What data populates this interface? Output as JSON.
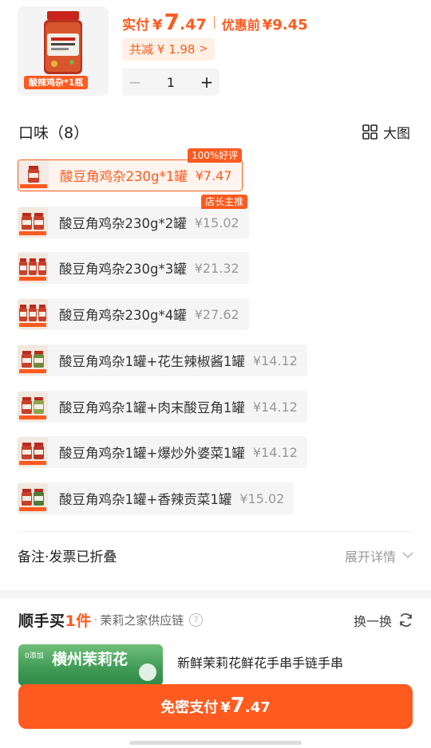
{
  "header": {
    "thumb_tag": "酸辣鸡杂*1瓶",
    "pay_label": "实付",
    "pay_currency": "¥",
    "pay_int": "7",
    "pay_dec": ".47",
    "orig_label": "优惠前",
    "orig_value": "¥9.45",
    "discount_text": "共减 ¥ 1.98",
    "quantity": "1",
    "minus": "−",
    "plus": "+"
  },
  "flavor": {
    "title": "口味（8）",
    "big_view_label": "大图",
    "options": [
      {
        "label": "酸豆角鸡杂230g*1罐",
        "price": "¥7.47",
        "badge": "100%好评",
        "selected": true
      },
      {
        "label": "酸豆角鸡杂230g*2罐",
        "price": "¥15.02",
        "badge": "店长主推"
      },
      {
        "label": "酸豆角鸡杂230g*3罐",
        "price": "¥21.32"
      },
      {
        "label": "酸豆角鸡杂230g*4罐",
        "price": "¥27.62"
      },
      {
        "label": "酸豆角鸡杂1罐+花生辣椒酱1罐",
        "price": "¥14.12"
      },
      {
        "label": "酸豆角鸡杂1罐+肉末酸豆角1罐",
        "price": "¥14.12"
      },
      {
        "label": "酸豆角鸡杂1罐+爆炒外婆菜1罐",
        "price": "¥14.12"
      },
      {
        "label": "酸豆角鸡杂1罐+香辣贡菜1罐",
        "price": "¥15.02"
      }
    ]
  },
  "remark": {
    "label": "备注·发票已折叠",
    "expand": "展开详情"
  },
  "recommend": {
    "brand_a": "顺手买",
    "brand_b": "1件",
    "shop": "茉莉之家供应链",
    "refresh": "换一换",
    "thumb_title": "横州茉莉花",
    "thumb_sub": "0添加",
    "item_title": "新鲜茉莉花鲜花手串手链手串"
  },
  "pay_button": {
    "label": "免密支付",
    "currency": "¥",
    "int": "7",
    "dec": ".47"
  },
  "colors": {
    "accent": "#ff5a1f",
    "accent_light": "#fff0e6",
    "muted": "#999999"
  }
}
